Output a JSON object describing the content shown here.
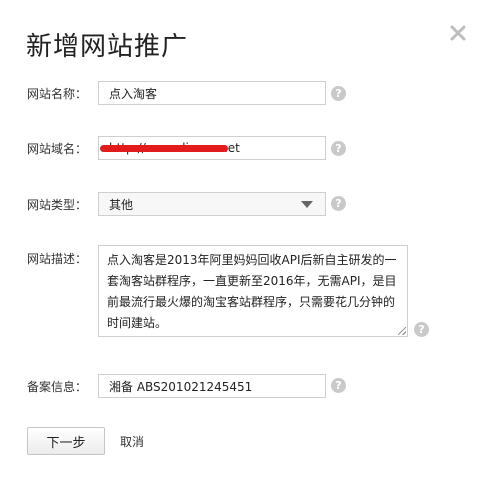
{
  "dialog": {
    "title": "新增网站推广"
  },
  "form": {
    "site_name": {
      "label": "网站名称：",
      "value": "点入淘客"
    },
    "site_domain": {
      "label": "网站域名：",
      "value": "http://www.dianru.net"
    },
    "site_type": {
      "label": "网站类型：",
      "selected": "其他"
    },
    "site_desc": {
      "label": "网站描述：",
      "value": "点入淘客是2013年阿里妈妈回收API后新自主研发的一套淘客站群程序，一直更新至2016年，无需API，是目前最流行最火爆的淘宝客站群程序，只需要花几分钟的时间建站。"
    },
    "icp": {
      "label": "备案信息：",
      "value": "湘备 ABS201021245451"
    }
  },
  "help_glyph": "?",
  "buttons": {
    "next": "下一步",
    "cancel": "取消"
  },
  "colors": {
    "redaction": "#e21c1c",
    "help_icon": "#c9c9c9"
  }
}
